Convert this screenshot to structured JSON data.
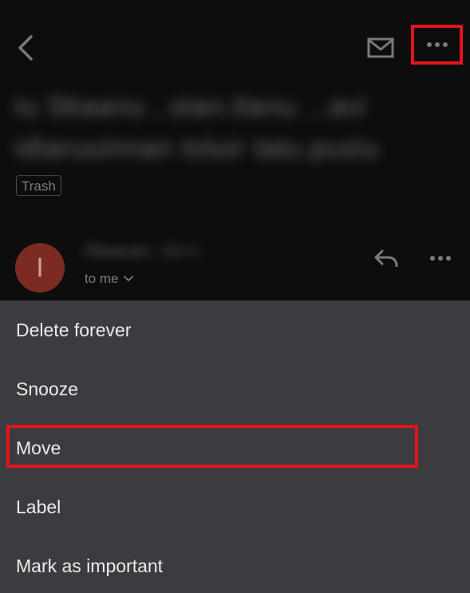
{
  "header": {
    "back_icon": "chevron-left-icon",
    "mail_icon": "envelope-icon",
    "more_icon": "more-horizontal-icon"
  },
  "email": {
    "subject_line1": "Iu Sbaanu ..stan.tlanu. ..avi",
    "subject_line2": "idtaruuinnan toluir tatu.pusiu",
    "label_chip": "Trash",
    "avatar_initial": "I",
    "sender_name": "Ilitaauen ·1ll·l·l",
    "recipient_text": "to me"
  },
  "menu": {
    "items": [
      {
        "label": "Delete forever"
      },
      {
        "label": "Snooze"
      },
      {
        "label": "Move"
      },
      {
        "label": "Label"
      },
      {
        "label": "Mark as important"
      }
    ]
  },
  "colors": {
    "highlight": "#e3141b",
    "sheet_background": "#3b3b40",
    "avatar": "#7c2b23"
  }
}
